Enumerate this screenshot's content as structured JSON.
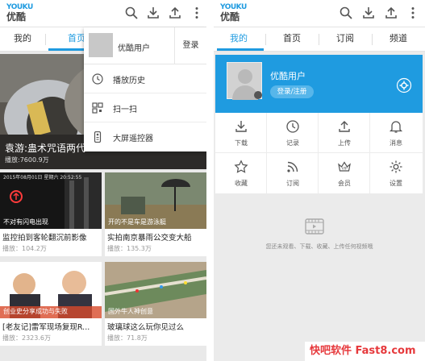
{
  "left": {
    "app": {
      "logo_en": "YOUKU",
      "logo_cn": "优酷"
    },
    "tabs": [
      {
        "label": "我的"
      },
      {
        "label": "首页"
      }
    ],
    "hero": {
      "title": "袁游:蛊术咒语两代",
      "views": "播放:7600.9万"
    },
    "videos": [
      {
        "overlay": "2015年08月01日 星期六 20:52:55 · 不对有闪电出现",
        "title": "监控拍到客轮翻沉前影像",
        "views": "播放：104.2万"
      },
      {
        "overlay": "开的不是车是游泳艇",
        "title": "实拍南京暴雨公交变大船",
        "views": "播放：135.3万"
      },
      {
        "overlay": "创业史分享成功与失败",
        "title": "[老友记]雷军现场复现R...",
        "views": "播放：2323.6万"
      },
      {
        "overlay": "国外牛人神创意",
        "title": "玻璃球这么玩你见过么",
        "views": "播放：71.8万"
      }
    ],
    "menu": {
      "username": "优酷用户",
      "login": "登录",
      "items": [
        {
          "label": "播放历史"
        },
        {
          "label": "扫一扫"
        },
        {
          "label": "大屏遥控器"
        }
      ]
    }
  },
  "right": {
    "app": {
      "logo_en": "YOUKU",
      "logo_cn": "优酷"
    },
    "tabs": [
      {
        "label": "我的"
      },
      {
        "label": "首页"
      },
      {
        "label": "订阅"
      },
      {
        "label": "频道"
      }
    ],
    "user": {
      "name": "优酷用户",
      "login_button": "登录/注册"
    },
    "grid": [
      {
        "label": "下载",
        "icon": "download-icon"
      },
      {
        "label": "记录",
        "icon": "clock-icon"
      },
      {
        "label": "上传",
        "icon": "upload-icon"
      },
      {
        "label": "消息",
        "icon": "bell-icon"
      },
      {
        "label": "收藏",
        "icon": "star-icon"
      },
      {
        "label": "订阅",
        "icon": "rss-icon"
      },
      {
        "label": "会员",
        "icon": "crown-icon"
      },
      {
        "label": "设置",
        "icon": "gear-icon"
      }
    ],
    "empty_text": "您还未观看、下载、收藏、上传任何视频哦"
  },
  "watermark": "快吧软件 Fast8.com",
  "colors": {
    "accent": "#1f9be0",
    "watermark": "#e6393c"
  }
}
